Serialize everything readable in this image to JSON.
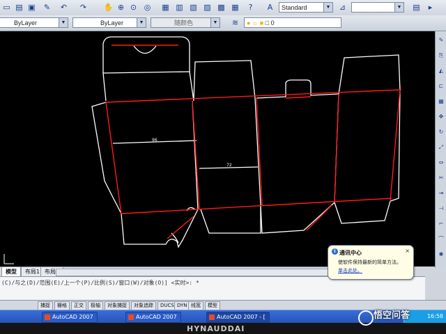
{
  "toolbar_top": {
    "style_combo": "Standard",
    "icons": [
      "pan-icon",
      "zoom-realtime-icon",
      "zoom-window-icon",
      "zoom-previous-icon",
      "properties-icon",
      "design-center-icon",
      "tool-palette-icon",
      "sheet-set-icon",
      "markup-icon",
      "calculator-icon"
    ]
  },
  "toolbar_props": {
    "layer_combo": "ByLayer",
    "linetype_combo": "ByLayer",
    "color_combo": "随颜色",
    "layer_name": "0"
  },
  "drawing": {
    "dimension_left": "96",
    "dimension_mid": "72",
    "colors": {
      "background": "#000000",
      "outline": "#ffffff",
      "fold": "#ff1a1a"
    }
  },
  "tabs": {
    "model": "模型",
    "layout1": "布局1",
    "layout2": "布局2"
  },
  "command": {
    "line1": "(C)/与之(D)/范围(E)/上一个(P)/比例(S)/窗口(W)/对象(O)] <实时>: *"
  },
  "balloon": {
    "title": "通讯中心",
    "body": "使软件保持最新的简单方法。",
    "link": "单击此处。",
    "close": "×"
  },
  "status": {
    "buttons": [
      "捕捉",
      "栅格",
      "正交",
      "极轴",
      "对象捕捉",
      "对象追踪",
      "DUCS",
      "DYN",
      "线宽",
      "模型"
    ]
  },
  "taskbar": {
    "items": [
      "AutoCAD 2007",
      "AutoCAD 2007",
      "AutoCAD 2007 - ["
    ],
    "clock": "16:58"
  },
  "monitor": {
    "brand": "HYNAUDDAI"
  },
  "watermark": "悟空问答"
}
